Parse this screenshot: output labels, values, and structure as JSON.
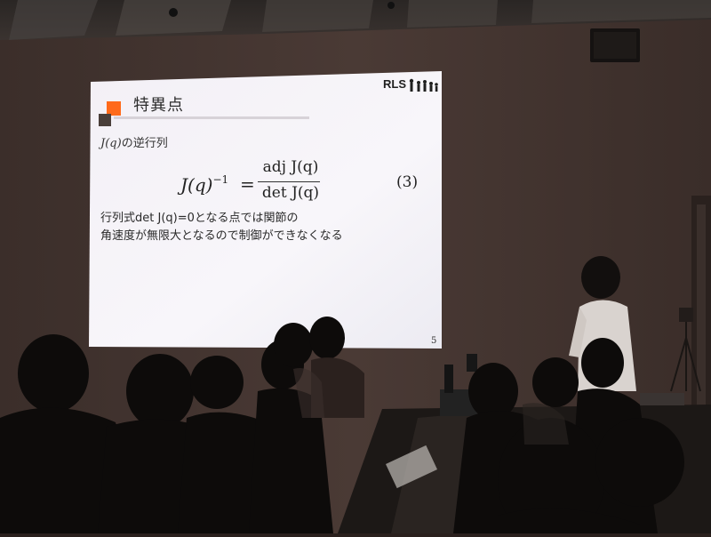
{
  "slide": {
    "title": "特異点",
    "line1_var": "J(q)",
    "line1_text": "の逆行列",
    "equation": {
      "lhs": "J(q)",
      "lhs_sup": "−1",
      "equals": "=",
      "numerator": "adj J(q)",
      "denominator": "det J(q)",
      "tag": "(3)"
    },
    "body_lines": [
      "行列式det J(q)=0となる点では関節の",
      "角速度が無限大となるので制御ができなくなる"
    ],
    "page_number": "5",
    "logo": {
      "text": "RLS",
      "icon": "robot-people-icon"
    },
    "accent_orange": "#ff6a1a",
    "accent_dark": "#4a3f3a"
  }
}
